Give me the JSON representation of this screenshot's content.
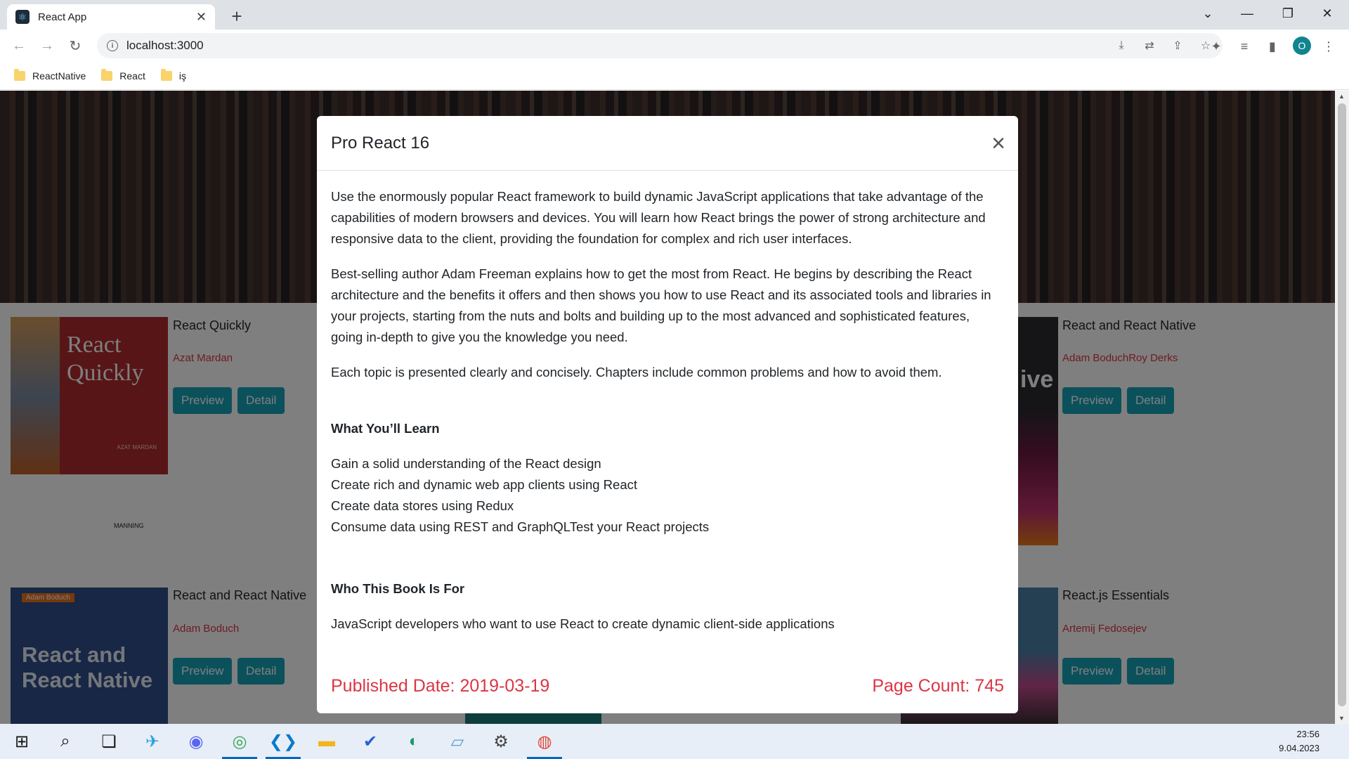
{
  "browser": {
    "tab_title": "React App",
    "url": "localhost:3000",
    "profile_initial": "O",
    "bookmarks": [
      "ReactNative",
      "React",
      "iş"
    ]
  },
  "page": {
    "cards": [
      {
        "title": "React Quickly",
        "author": "Azat Mardan",
        "cover_text": "React Quickly",
        "cover_author": "AZAT MARDAN",
        "publisher": "MANNING"
      },
      {
        "title": "React and React Native",
        "author": "Adam BoduchRoy Derks",
        "cover_text": "ive"
      },
      {
        "title": "React and React Native",
        "author": "Adam Boduch",
        "cover_text": "React and React Native",
        "cover_author": "Adam Boduch"
      },
      {
        "title": "React.js Essentials",
        "author": "Artemij Fedosejev"
      }
    ],
    "preview_label": "Preview",
    "detail_label": "Detail"
  },
  "modal": {
    "title": "Pro React 16",
    "close_glyph": "×",
    "paragraphs": [
      "Use the enormously popular React framework to build dynamic JavaScript applications that take advantage of the capabilities of modern browsers and devices. You will learn how React brings the power of strong architecture and responsive data to the client, providing the foundation for complex and rich user interfaces.",
      "Best-selling author Adam Freeman explains how to get the most from React. He begins by describing the React architecture and the benefits it offers and then shows you how to use React and its associated tools and libraries in your projects, starting from the nuts and bolts and building up to the most advanced and sophisticated features, going in-depth to give you the knowledge you need.",
      "Each topic is presented clearly and concisely. Chapters include common problems and how to avoid them."
    ],
    "learn_heading": "What You’ll Learn",
    "learn_items": [
      "Gain a solid understanding of the React design",
      "Create rich and dynamic web app clients using React",
      "Create data stores using Redux",
      "Consume data using REST and GraphQLTest your React projects"
    ],
    "audience_heading": "Who This Book Is For",
    "audience_text": "JavaScript developers who want to use React to create dynamic client-side applications",
    "published_date": "Published Date: 2019-03-19",
    "page_count": "Page Count: 745"
  },
  "taskbar": {
    "time": "23:56",
    "date": "9.04.2023"
  },
  "colors": {
    "accent_button": "#17a2b8",
    "author_red": "#dc3545"
  }
}
